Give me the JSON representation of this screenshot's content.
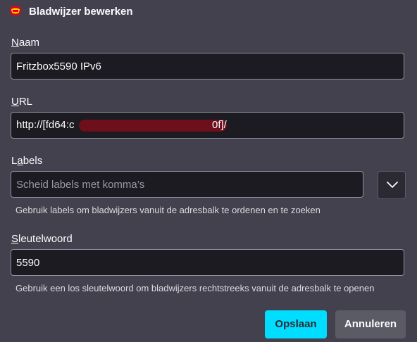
{
  "dialog": {
    "title": "Bladwijzer bewerken"
  },
  "name_field": {
    "label_access": "N",
    "label_rest": "aam",
    "value": "Fritzbox5590 IPv6"
  },
  "url_field": {
    "label_access": "U",
    "label_rest": "RL",
    "value_visible_start": "http://[fd64:c",
    "value_visible_end": "0f]/"
  },
  "labels_field": {
    "label_pre": "L",
    "label_access": "a",
    "label_rest": "bels",
    "placeholder": "Scheid labels met komma’s",
    "hint": "Gebruik labels om bladwijzers vanuit de adresbalk te ordenen en te zoeken",
    "dropdown_icon": "chevron-down-icon"
  },
  "keyword_field": {
    "label_access": "S",
    "label_rest": "leutelwoord",
    "value": "5590",
    "hint": "Gebruik een los sleutelwoord om bladwijzers rechtstreeks vanuit de adresbalk te openen"
  },
  "buttons": {
    "save": "Opslaan",
    "cancel": "Annuleren"
  },
  "colors": {
    "background": "#42414d",
    "field_bg": "#1c1b22",
    "accent": "#00ddff",
    "redaction": "#6e0f1c"
  }
}
